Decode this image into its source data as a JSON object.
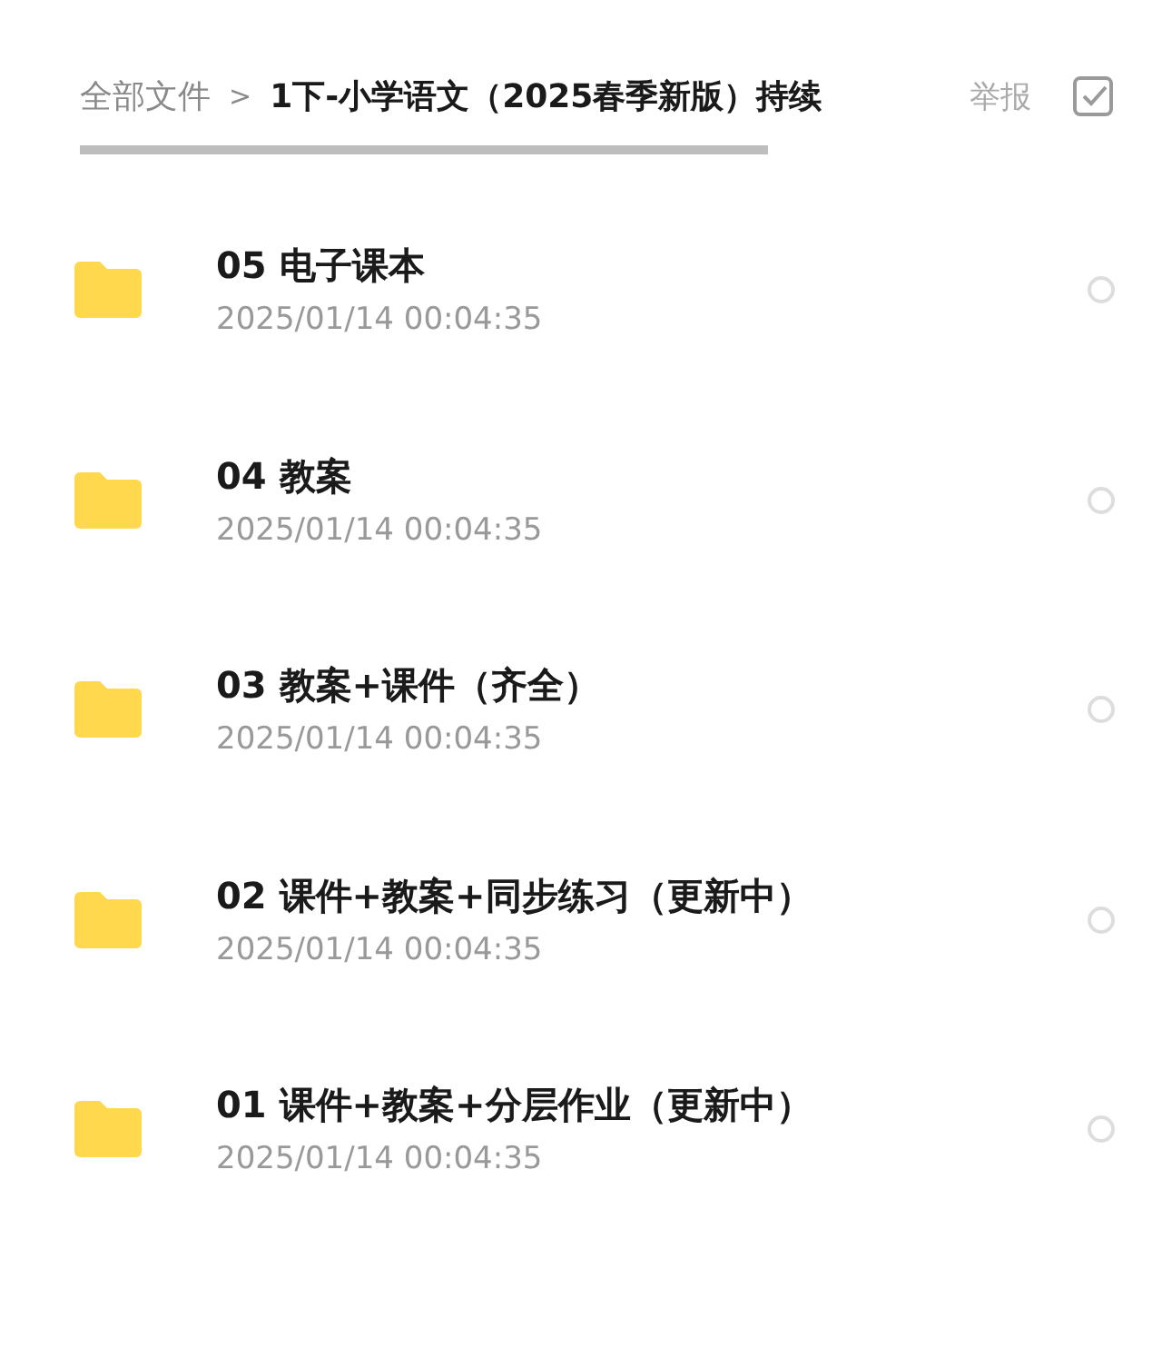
{
  "breadcrumb": {
    "root": "全部文件",
    "separator": ">",
    "current": "1下-小学语文（2025春季新版）持续"
  },
  "actions": {
    "report": "举报"
  },
  "files": [
    {
      "name": "05 电子课本",
      "date": "2025/01/14 00:04:35",
      "selected": false
    },
    {
      "name": "04 教案",
      "date": "2025/01/14 00:04:35",
      "selected": false
    },
    {
      "name": "03 教案+课件（齐全）",
      "date": "2025/01/14 00:04:35",
      "selected": false
    },
    {
      "name": "02 课件+教案+同步练习（更新中）",
      "date": "2025/01/14 00:04:35",
      "selected": false
    },
    {
      "name": "01 课件+教案+分层作业（更新中）",
      "date": "2025/01/14 00:04:35",
      "selected": false
    }
  ]
}
